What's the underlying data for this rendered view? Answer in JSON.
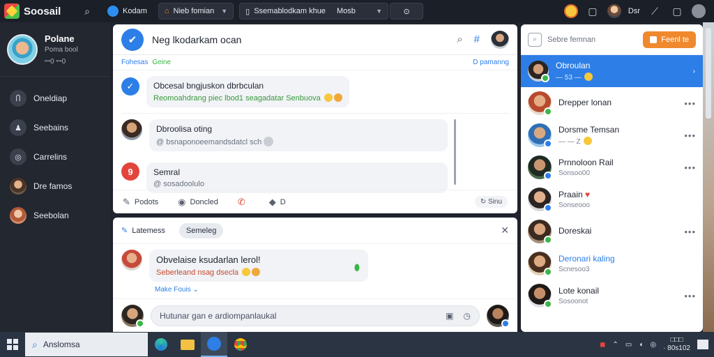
{
  "topbar": {
    "app_name": "Soosail",
    "tab1": "Kodam",
    "tab2": "Nieb fomian",
    "tab3": "Ssemablodkam khue",
    "tab3_extra": "Mosb",
    "user_short": "Dsr"
  },
  "profile": {
    "name": "Polane",
    "sub1": "Poma bool",
    "sub2": "ꟷ0 ꟷ0"
  },
  "sidebar": {
    "items": [
      {
        "label": "Oneldiap"
      },
      {
        "label": "Seebains"
      },
      {
        "label": "Carrelins"
      },
      {
        "label": "Dre famos"
      },
      {
        "label": "Seebolan"
      }
    ]
  },
  "main": {
    "title": "Neg lkodarkam ocan",
    "subnav_left": "Fohesas",
    "subnav_green": "Geine",
    "subnav_right": "D pamanng",
    "messages": [
      {
        "title": "Obcesal bngjuskon dbrbculan",
        "sub": "Reomoahdrang piec lbod1 seagadatar Senbuova"
      },
      {
        "title": "Dbroolisa oting",
        "sub": "@ bsnaponoeemandsdatcl sch"
      },
      {
        "title": "Semral",
        "sub": "@ sosadoolulo",
        "badge": "9"
      }
    ],
    "actions": {
      "a1": "Podots",
      "a2": "Doncled",
      "a3": "",
      "a4": "D",
      "right": "Sinu"
    }
  },
  "bottom": {
    "tab": "Latemess",
    "pill": "Semeleg",
    "message_title": "Obvelaise ksudarlan lerol!",
    "message_sub": "Seberleand nsag dsecla",
    "reply_link": "Make  Fouis  ⌄",
    "compose_placeholder": "Hutunar gan e ardiompanlaukal"
  },
  "right": {
    "search": "Sebre femnan",
    "button": "Feenl te",
    "contacts": [
      {
        "name": "Obroulan",
        "sub": "— 53 —",
        "active": true
      },
      {
        "name": "Drepper lonan",
        "sub": ""
      },
      {
        "name": "Dorsme Temsan",
        "sub": "— — Z"
      },
      {
        "name": "Prnnoloon Rail",
        "sub": "Sonsoo00"
      },
      {
        "name": "Praain",
        "sub": "Sonseooo"
      },
      {
        "name": "Doreskai",
        "sub": ""
      },
      {
        "name": "Deronari kaling",
        "sub": "Scnesoo3"
      },
      {
        "name": "Lote konail",
        "sub": "Sosoonot"
      }
    ]
  },
  "taskbar": {
    "search": "Anslomsa",
    "time": "□□□",
    "date": "· 80s102"
  },
  "colors": {
    "accent": "#2d7ee6",
    "orange": "#f0892e",
    "green": "#3bb54a",
    "dark": "#23272f"
  }
}
